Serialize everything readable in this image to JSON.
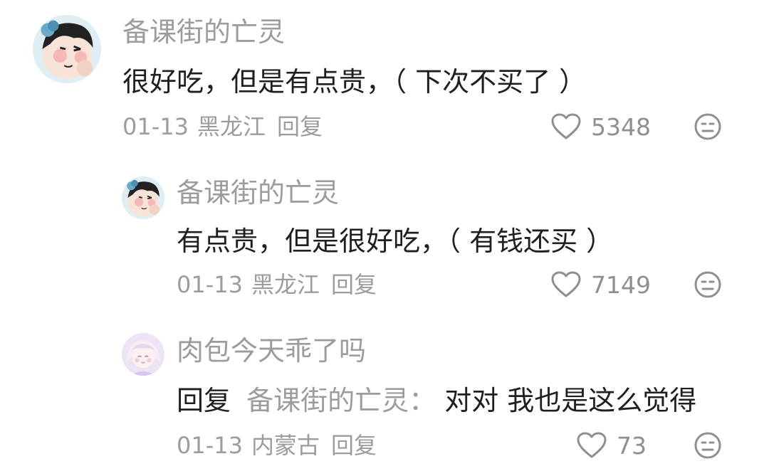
{
  "comments": [
    {
      "username": "备课街的亡灵",
      "text": "很好吃，但是有点贵，（ 下次不买了 ）",
      "date": "01-13",
      "location": "黑龙江",
      "reply_label": "回复",
      "likes": "5348"
    },
    {
      "username": "备课街的亡灵",
      "text": "有点贵，但是很好吃，（ 有钱还买 ）",
      "date": "01-13",
      "location": "黑龙江",
      "reply_label": "回复",
      "likes": "7149"
    },
    {
      "username": "肉包今天乖了吗",
      "reply_prefix": "回复",
      "reply_to": "备课街的亡灵：",
      "text": "对对 我也是这么觉得",
      "date": "01-13",
      "location": "内蒙古",
      "reply_label": "回复",
      "likes": "73"
    }
  ],
  "colors": {
    "meta_gray": "#9c9c9c",
    "text_dark": "#1f1f1f",
    "background": "#ffffff"
  },
  "icons": {
    "like": "heart-outline-icon",
    "dislike": "meh-face-icon",
    "avatar_1": "cartoon-boy-avatar",
    "avatar_2": "cartoon-girl-avatar"
  }
}
